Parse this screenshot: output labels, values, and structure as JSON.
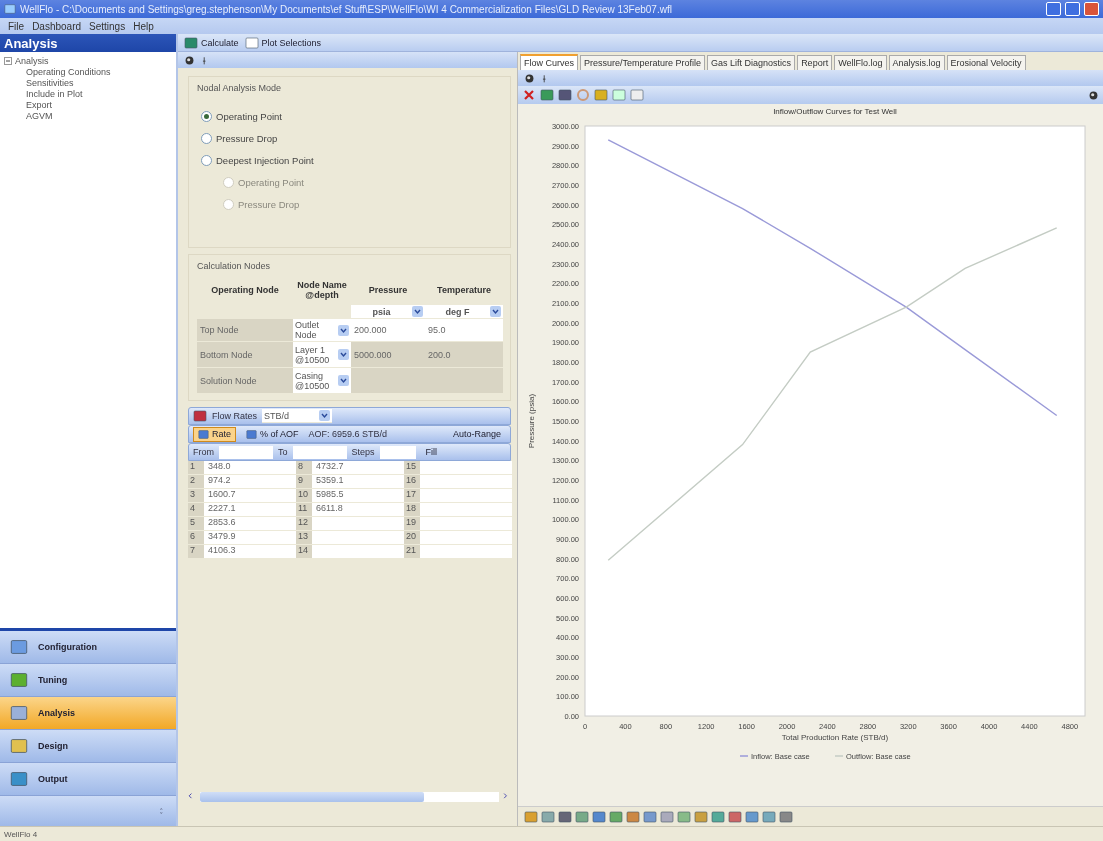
{
  "window": {
    "title": "WellFlo - C:\\Documents and Settings\\greg.stephenson\\My Documents\\ef Stuff\\ESP\\WellFlo\\WI 4 Commercialization Files\\GLD Review 13Feb07.wfl"
  },
  "menu": [
    "File",
    "Dashboard",
    "Settings",
    "Help"
  ],
  "sidebar": {
    "title": "Analysis",
    "tree": [
      {
        "label": "Analysis",
        "expanded": true,
        "children": [
          {
            "label": "Operating Conditions"
          },
          {
            "label": "Sensitivities"
          },
          {
            "label": "Include in Plot"
          },
          {
            "label": "Export"
          },
          {
            "label": "AGVM"
          }
        ]
      }
    ]
  },
  "navigation": {
    "items": [
      {
        "label": "Configuration",
        "kind": "configuration",
        "selected": false
      },
      {
        "label": "Tuning",
        "kind": "tuning",
        "selected": false
      },
      {
        "label": "Analysis",
        "kind": "analysis",
        "selected": true
      },
      {
        "label": "Design",
        "kind": "design",
        "selected": false
      },
      {
        "label": "Output",
        "kind": "output",
        "selected": false
      }
    ]
  },
  "toolbar": [
    "Calculate",
    "Plot Selections"
  ],
  "analysis_mode": {
    "title": "Nodal Analysis Mode",
    "options": [
      {
        "label": "Operating Point",
        "selected": true,
        "disabled": false,
        "sub": false
      },
      {
        "label": "Pressure Drop",
        "selected": false,
        "disabled": false,
        "sub": false
      },
      {
        "label": "Deepest Injection Point",
        "selected": false,
        "disabled": false,
        "sub": false
      },
      {
        "label": "Operating Point",
        "selected": false,
        "disabled": true,
        "sub": true
      },
      {
        "label": "Pressure Drop",
        "selected": false,
        "disabled": true,
        "sub": true
      }
    ]
  },
  "calculation_nodes": {
    "title": "Calculation Nodes",
    "columns": [
      "Operating Node",
      "Node Name @depth",
      "Pressure",
      "Temperature"
    ],
    "units": [
      "psia",
      "deg F"
    ],
    "rows": [
      {
        "operating_node": "Top Node",
        "node_name": "Outlet Node",
        "pressure": "200.000",
        "temperature": "95.0"
      },
      {
        "operating_node": "Bottom Node",
        "node_name": "Layer 1 @10500",
        "pressure": "5000.000",
        "temperature": "200.0"
      },
      {
        "operating_node": "Solution Node",
        "node_name": "Casing @10500"
      }
    ]
  },
  "flow_rates": {
    "label": "Flow Rates",
    "unit": "STB/d",
    "modes": [
      {
        "label": "Rate",
        "selected": true
      },
      {
        "label": "% of AOF",
        "selected": false
      }
    ],
    "aof": "AOF: 6959.6 STB/d",
    "auto_range": "Auto-Range",
    "range_labels": [
      "From",
      "To",
      "Steps"
    ],
    "fill": "Fill",
    "rows": [
      {
        "index": "1",
        "value": "348.0"
      },
      {
        "index": "2",
        "value": "974.2"
      },
      {
        "index": "3",
        "value": "1600.7"
      },
      {
        "index": "4",
        "value": "2227.1"
      },
      {
        "index": "5",
        "value": "2853.6"
      },
      {
        "index": "6",
        "value": "3479.9"
      },
      {
        "index": "7",
        "value": "4106.3"
      },
      {
        "index": "8",
        "value": "4732.7"
      },
      {
        "index": "9",
        "value": "5359.1"
      },
      {
        "index": "10",
        "value": "5985.5"
      },
      {
        "index": "11",
        "value": "6611.8"
      },
      {
        "index": "12"
      },
      {
        "index": "13"
      },
      {
        "index": "14"
      },
      {
        "index": "15"
      },
      {
        "index": "16"
      },
      {
        "index": "17"
      },
      {
        "index": "18"
      },
      {
        "index": "19"
      },
      {
        "index": "20"
      },
      {
        "index": "21"
      }
    ]
  },
  "tabs": [
    {
      "label": "Flow Curves",
      "selected": true
    },
    {
      "label": "Pressure/Temperature Profile",
      "selected": false
    },
    {
      "label": "Gas Lift Diagnostics",
      "selected": false
    },
    {
      "label": "Report",
      "selected": false
    },
    {
      "label": "WellFlo.log",
      "selected": false
    },
    {
      "label": "Analysis.log",
      "selected": false
    },
    {
      "label": "Erosional Velocity",
      "selected": false
    }
  ],
  "chart": {
    "chart_data": {
      "type": "line",
      "title": "Inflow/Outflow Curves for Test Well",
      "xlabel": "Total Production Rate (STB/d)",
      "ylabel": "Pressure (psia)",
      "x": [
        230,
        1560,
        2230,
        3180,
        3763,
        4670
      ],
      "series": [
        {
          "name": "Inflow: Base case",
          "color": "#9a9ad8",
          "values": [
            2930,
            2580,
            2378,
            2079,
            1863,
            1528
          ]
        },
        {
          "name": "Outflow: Base case",
          "color": "#c4ccc4",
          "values": [
            792,
            1380,
            1850,
            2079,
            2276,
            2482
          ]
        }
      ],
      "xlim": [
        0,
        4950
      ],
      "ylim": [
        0,
        3000
      ],
      "legend": "bottom",
      "xticks": [
        {
          "value": 0,
          "label": "0"
        },
        {
          "value": 400,
          "label": "400"
        },
        {
          "value": 800,
          "label": "800"
        },
        {
          "value": 1200,
          "label": "1200"
        },
        {
          "value": 1600,
          "label": "1600"
        },
        {
          "value": 2000,
          "label": "2000"
        },
        {
          "value": 2400,
          "label": "2400"
        },
        {
          "value": 2800,
          "label": "2800"
        },
        {
          "value": 3200,
          "label": "3200"
        },
        {
          "value": 3600,
          "label": "3600"
        },
        {
          "value": 4000,
          "label": "4000"
        },
        {
          "value": 4400,
          "label": "4400"
        },
        {
          "value": 4800,
          "label": "4800"
        }
      ],
      "yticks": [
        {
          "value": 0,
          "label": "0.00"
        },
        {
          "value": 100,
          "label": "100.00"
        },
        {
          "value": 200,
          "label": "200.00"
        },
        {
          "value": 300,
          "label": "300.00"
        },
        {
          "value": 400,
          "label": "400.00"
        },
        {
          "value": 500,
          "label": "500.00"
        },
        {
          "value": 600,
          "label": "600.00"
        },
        {
          "value": 700,
          "label": "700.00"
        },
        {
          "value": 800,
          "label": "800.00"
        },
        {
          "value": 900,
          "label": "900.00"
        },
        {
          "value": 1000,
          "label": "1000.00"
        },
        {
          "value": 1100,
          "label": "1100.00"
        },
        {
          "value": 1200,
          "label": "1200.00"
        },
        {
          "value": 1300,
          "label": "1300.00"
        },
        {
          "value": 1400,
          "label": "1400.00"
        },
        {
          "value": 1500,
          "label": "1500.00"
        },
        {
          "value": 1600,
          "label": "1600.00"
        },
        {
          "value": 1700,
          "label": "1700.00"
        },
        {
          "value": 1800,
          "label": "1800.00"
        },
        {
          "value": 1900,
          "label": "1900.00"
        },
        {
          "value": 2000,
          "label": "2000.00"
        },
        {
          "value": 2100,
          "label": "2100.00"
        },
        {
          "value": 2200,
          "label": "2200.00"
        },
        {
          "value": 2300,
          "label": "2300.00"
        },
        {
          "value": 2400,
          "label": "2400.00"
        },
        {
          "value": 2500,
          "label": "2500.00"
        },
        {
          "value": 2600,
          "label": "2600.00"
        },
        {
          "value": 2700,
          "label": "2700.00"
        },
        {
          "value": 2800,
          "label": "2800.00"
        },
        {
          "value": 2900,
          "label": "2900.00"
        },
        {
          "value": 3000,
          "label": "3000.00"
        }
      ]
    }
  },
  "status_bar": {
    "text": "WellFlo 4"
  }
}
